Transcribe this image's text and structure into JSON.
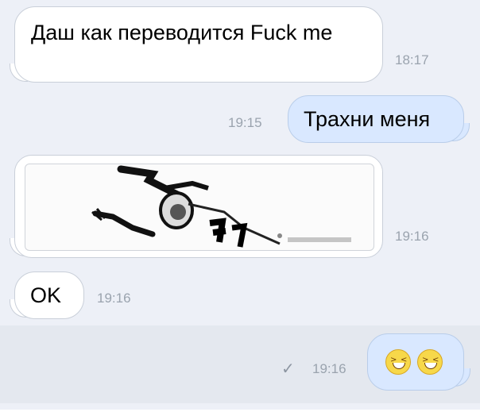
{
  "messages": [
    {
      "direction": "incoming",
      "text": "Даш как переводится Fuck me",
      "time": "18:17"
    },
    {
      "direction": "outgoing",
      "text": "Трахни меня",
      "time": "19:15"
    },
    {
      "direction": "incoming",
      "kind": "sticker",
      "sticker_icon": "cartoon-man-sticker",
      "time": "19:16"
    },
    {
      "direction": "incoming",
      "text": "OK",
      "time": "19:16"
    },
    {
      "direction": "outgoing",
      "kind": "emoji",
      "emoji_icon": "grinning-squinting-face-icon",
      "status_icon": "checkmark-icon",
      "time": "19:16"
    }
  ],
  "colors": {
    "background": "#edf0f7",
    "incoming_bubble": "#ffffff",
    "outgoing_bubble": "#d9e8ff",
    "timestamp": "#9aa3ae"
  }
}
